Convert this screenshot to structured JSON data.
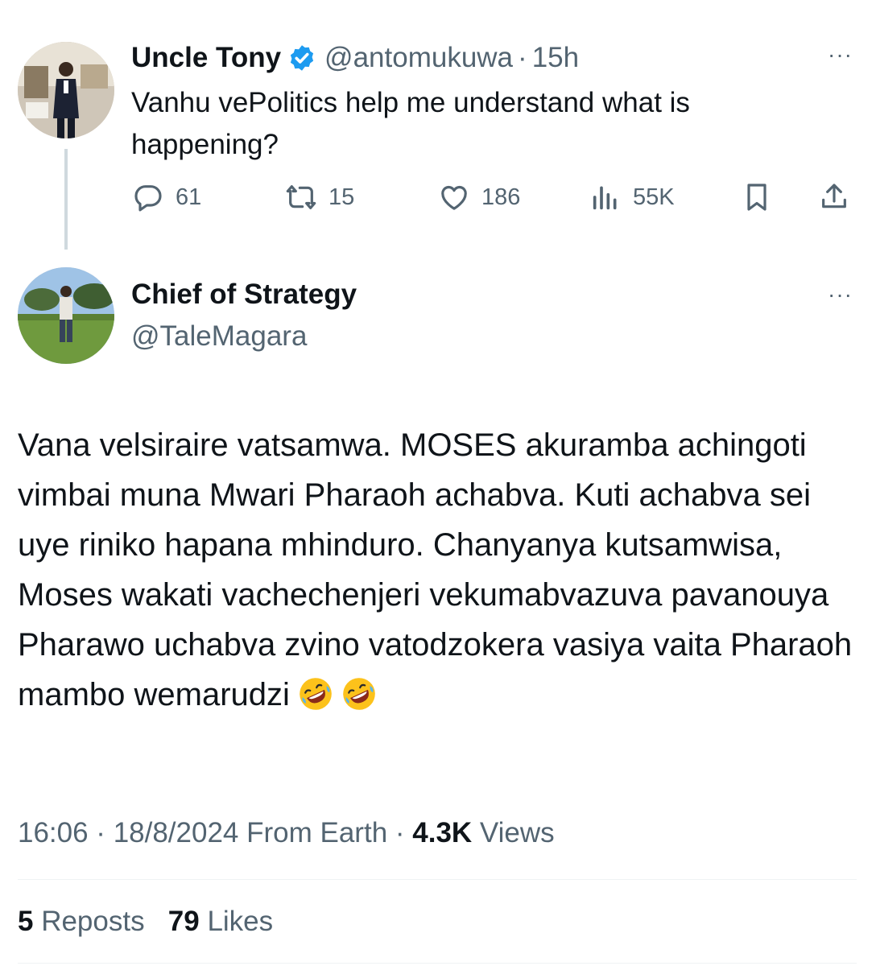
{
  "parent": {
    "author_name": "Uncle Tony",
    "handle": "@antomukuwa",
    "separator": "·",
    "time": "15h",
    "text": "Vanhu vePolitics help me understand what is happening?",
    "more": "···",
    "actions": {
      "reply_count": "61",
      "repost_count": "15",
      "like_count": "186",
      "view_count": "55K"
    }
  },
  "reply": {
    "author_name": "Chief of Strategy",
    "handle": "@TaleMagara",
    "more": "···",
    "text": "Vana velsiraire vatsamwa. MOSES akuramba achingoti vimbai muna Mwari Pharaoh achabva. Kuti achabva sei uye riniko hapana mhinduro. Chanyanya kutsamwisa,  Moses wakati vachechenjeri vekumabvazuva pavanouya Pharawo uchabva zvino vatodzokera vasiya vaita Pharaoh mambo wemarudzi",
    "emojis": [
      "rolling-on-floor-laughing-emoji",
      "rolling-on-floor-laughing-emoji"
    ],
    "timestamp": "16:06 · 18/8/2024 From Earth · ",
    "views_count": "4.3K",
    "views_label": " Views",
    "reposts_count": "5",
    "reposts_label": " Reposts",
    "likes_count": "79",
    "likes_label": " Likes"
  },
  "colors": {
    "text": "#0f1419",
    "muted": "#536471",
    "verified": "#1d9bf0",
    "divider": "#eff3f4"
  }
}
